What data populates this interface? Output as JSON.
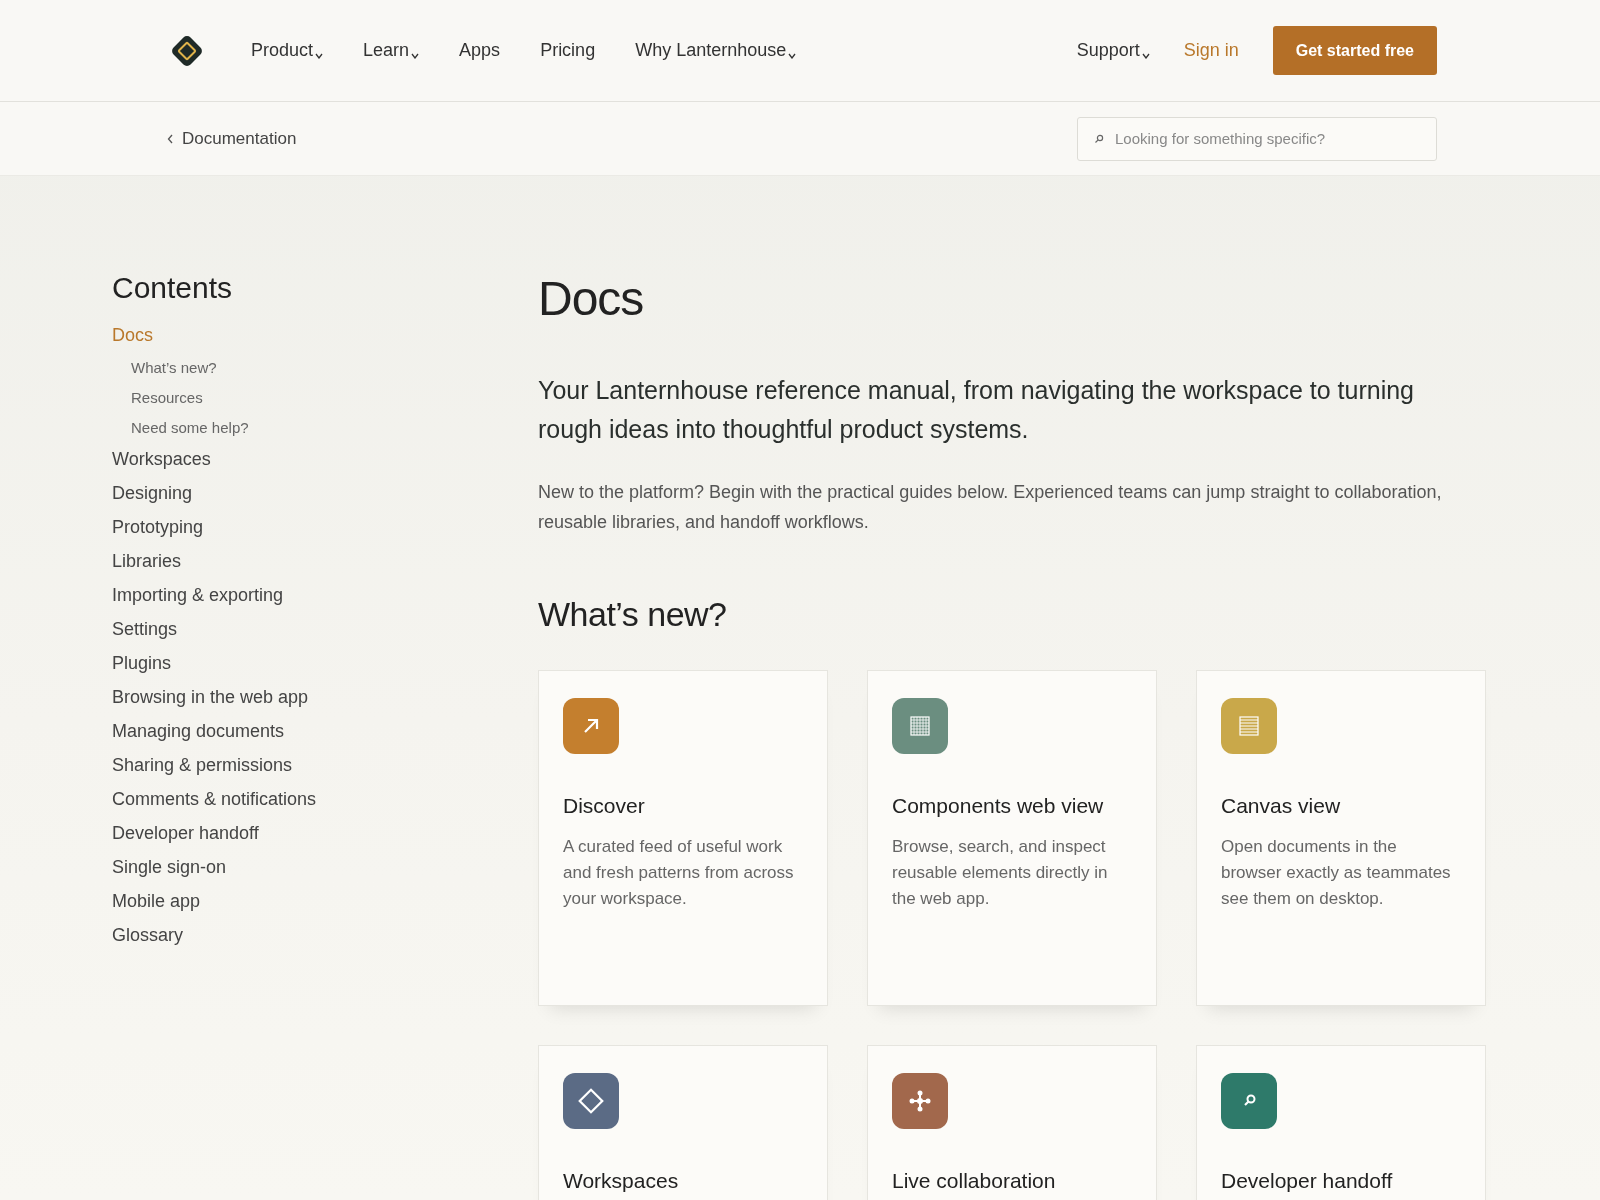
{
  "header": {
    "nav": [
      {
        "label": "Product",
        "has_menu": true
      },
      {
        "label": "Learn",
        "has_menu": true
      },
      {
        "label": "Apps",
        "has_menu": false
      },
      {
        "label": "Pricing",
        "has_menu": false
      },
      {
        "label": "Why Lanternhouse",
        "has_menu": true
      }
    ],
    "support": {
      "label": "Support",
      "has_menu": true
    },
    "sign_in": "Sign in",
    "cta": "Get started free"
  },
  "subheader": {
    "back_link": "Documentation",
    "search": {
      "placeholder": "Looking for something specific?"
    }
  },
  "sidebar": {
    "title": "Contents",
    "items": [
      {
        "label": "Docs",
        "selected": true,
        "children": [
          {
            "label": "What’s new?",
            "selected": false
          },
          {
            "label": "Resources",
            "selected": false
          },
          {
            "label": "Need some help?",
            "selected": false
          }
        ]
      },
      {
        "label": "Workspaces",
        "selected": false
      },
      {
        "label": "Designing",
        "selected": false
      },
      {
        "label": "Prototyping",
        "selected": false
      },
      {
        "label": "Libraries",
        "selected": false
      },
      {
        "label": "Importing & exporting",
        "selected": false
      },
      {
        "label": "Settings",
        "selected": false
      },
      {
        "label": "Plugins",
        "selected": false
      },
      {
        "label": "Browsing in the web app",
        "selected": false
      },
      {
        "label": "Managing documents",
        "selected": false
      },
      {
        "label": "Sharing & permissions",
        "selected": false
      },
      {
        "label": "Comments & notifications",
        "selected": false
      },
      {
        "label": "Developer handoff",
        "selected": false
      },
      {
        "label": "Single sign-on",
        "selected": false
      },
      {
        "label": "Mobile app",
        "selected": false
      },
      {
        "label": "Glossary",
        "selected": false
      }
    ]
  },
  "main": {
    "title": "Docs",
    "lead": "Your Lanternhouse reference manual, from navigating the workspace to turning rough ideas into thoughtful product systems.",
    "intro": "New to the platform? Begin with the practical guides below. Experienced teams can jump straight to collaboration, reusable libraries, and handoff workflows.",
    "section_title": "What’s new?",
    "cards": [
      {
        "kind": "arrow",
        "color": "#c47f2e",
        "title": "Discover",
        "text": "A curated feed of useful work and fresh patterns from across your workspace."
      },
      {
        "kind": "grid",
        "color": "#6b8e80",
        "title": "Components web view",
        "text": "Browse, search, and inspect reusable elements directly in the web app."
      },
      {
        "kind": "lines",
        "color": "#c9a84a",
        "title": "Canvas view",
        "text": "Open documents in the browser exactly as teammates see them on desktop."
      },
      {
        "kind": "diamond",
        "color": "#5b6b85",
        "title": "Workspaces"
      },
      {
        "kind": "network",
        "color": "#a2684c",
        "title": "Live collaboration"
      },
      {
        "kind": "search",
        "color": "#2e7a6a",
        "title": "Developer handoff"
      }
    ]
  }
}
